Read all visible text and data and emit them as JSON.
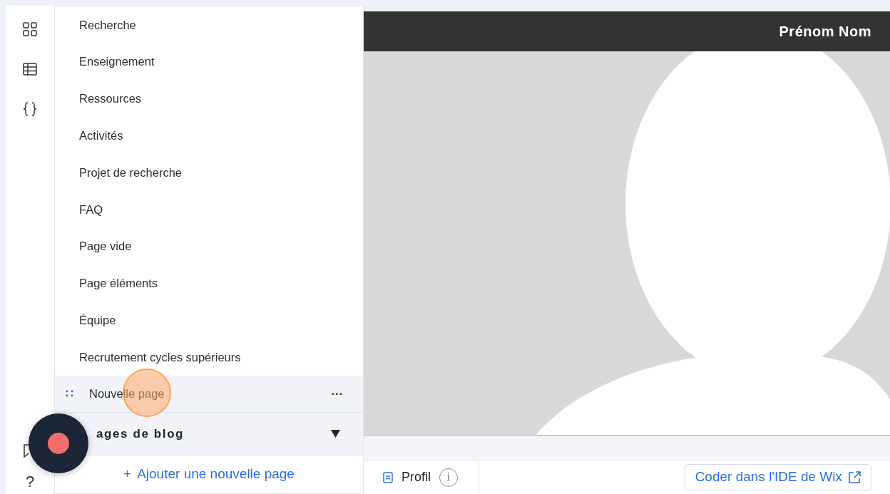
{
  "rail": {
    "help_label": "?"
  },
  "pages": [
    {
      "label": "Recherche",
      "selected": false
    },
    {
      "label": "Enseignement",
      "selected": false
    },
    {
      "label": "Ressources",
      "selected": false
    },
    {
      "label": "Activités",
      "selected": false
    },
    {
      "label": "Projet de recherche",
      "selected": false
    },
    {
      "label": "FAQ",
      "selected": false
    },
    {
      "label": "Page vide",
      "selected": false
    },
    {
      "label": "Page éléments",
      "selected": false
    },
    {
      "label": "Équipe",
      "selected": false
    },
    {
      "label": "Recrutement cycles supérieurs",
      "selected": false
    },
    {
      "label": "Nouvelle page",
      "selected": true
    }
  ],
  "more_label": "···",
  "blog_section": {
    "label": "ages de blog",
    "expanded": true
  },
  "add_page": {
    "plus": "+",
    "label": "Ajouter une nouvelle page"
  },
  "preview": {
    "header_name": "Prénom Nom"
  },
  "bottom_bar": {
    "page_label": "Profil",
    "info": "i",
    "code_button": "Coder dans l'IDE de Wix"
  },
  "recorder": {
    "recording": true
  }
}
